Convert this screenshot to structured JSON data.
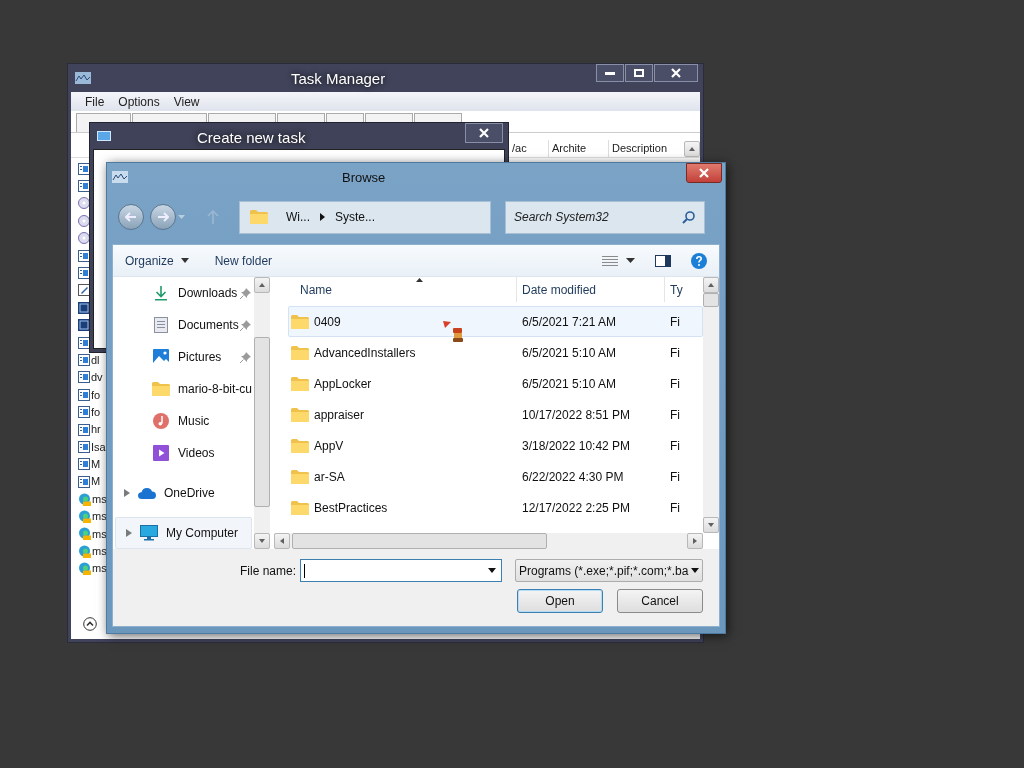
{
  "task_manager": {
    "title": "Task Manager",
    "menu": [
      "File",
      "Options",
      "View"
    ],
    "columns": [
      "/ac",
      "Archite",
      "Description"
    ],
    "rows": [
      {
        "kind": "app"
      },
      {
        "kind": "app"
      },
      {
        "kind": "disc"
      },
      {
        "kind": "disc"
      },
      {
        "kind": "disc"
      },
      {
        "kind": "app"
      },
      {
        "kind": "app"
      },
      {
        "kind": "editor"
      },
      {
        "kind": "service"
      },
      {
        "kind": "service"
      },
      {
        "kind": "app"
      },
      {
        "kind": "app",
        "name": "dl"
      },
      {
        "kind": "app",
        "name": "dv"
      },
      {
        "kind": "app",
        "name": "fo"
      },
      {
        "kind": "app",
        "name": "fo"
      },
      {
        "kind": "app",
        "name": "hr"
      },
      {
        "kind": "app",
        "name": "Isa"
      },
      {
        "kind": "app",
        "name": "M"
      },
      {
        "kind": "app",
        "name": "M"
      },
      {
        "kind": "edge",
        "name": "ms"
      },
      {
        "kind": "edge",
        "name": "ms"
      },
      {
        "kind": "edge",
        "name": "ms"
      },
      {
        "kind": "edge",
        "name": "ms"
      },
      {
        "kind": "edge",
        "name": "ms"
      }
    ]
  },
  "create_task": {
    "title": "Create new task"
  },
  "browse": {
    "title": "Browse",
    "breadcrumb": [
      "Wi...",
      "Syste..."
    ],
    "search": {
      "placeholder": "Search System32"
    },
    "toolbar": [
      {
        "label": "Organize",
        "dropdown": true
      },
      {
        "label": "New folder",
        "dropdown": false
      }
    ],
    "nav": [
      {
        "label": "Downloads",
        "kind": "downloads",
        "pinned": true,
        "selected": false
      },
      {
        "label": "Documents",
        "kind": "documents",
        "pinned": true,
        "selected": false
      },
      {
        "label": "Pictures",
        "kind": "pictures",
        "pinned": true,
        "selected": false
      },
      {
        "label": "mario-8-bit-cu",
        "kind": "folder",
        "pinned": false,
        "selected": false
      },
      {
        "label": "Music",
        "kind": "music",
        "pinned": false,
        "selected": false
      },
      {
        "label": "Videos",
        "kind": "videos",
        "pinned": false,
        "selected": false
      },
      {
        "label": "OneDrive",
        "kind": "cloud",
        "expandable": true,
        "selected": false
      },
      {
        "label": "My Computer",
        "kind": "computer",
        "expandable": true,
        "selected": true
      }
    ],
    "columns": [
      "Name",
      "Date modified",
      "Ty"
    ],
    "files": [
      {
        "name": "0409",
        "date": "6/5/2021 7:21 AM",
        "type": "Fi",
        "selected": true
      },
      {
        "name": "AdvancedInstallers",
        "date": "6/5/2021 5:10 AM",
        "type": "Fi",
        "selected": false
      },
      {
        "name": "AppLocker",
        "date": "6/5/2021 5:10 AM",
        "type": "Fi",
        "selected": false
      },
      {
        "name": "appraiser",
        "date": "10/17/2022 8:51 PM",
        "type": "Fi",
        "selected": false
      },
      {
        "name": "AppV",
        "date": "3/18/2022 10:42 PM",
        "type": "Fi",
        "selected": false
      },
      {
        "name": "ar-SA",
        "date": "6/22/2022 4:30 PM",
        "type": "Fi",
        "selected": false
      },
      {
        "name": "BestPractices",
        "date": "12/17/2022 2:25 PM",
        "type": "Fi",
        "selected": false
      }
    ],
    "file_name_label": "File name:",
    "file_type": "Programs (*.exe;*.pif;*.com;*.ba",
    "buttons": [
      {
        "label": "Open",
        "default": true
      },
      {
        "label": "Cancel",
        "default": false
      }
    ]
  }
}
